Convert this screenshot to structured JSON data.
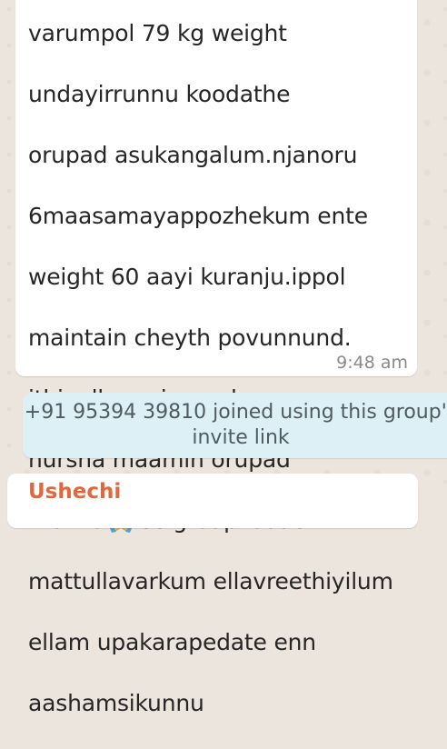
{
  "colors": {
    "wallpaper": "#ece5dd",
    "bubble": "#ffffff",
    "system_note_bg": "#dcf0f5",
    "sender_name": "#e4663b",
    "timestamp": "#8a8a8a"
  },
  "message": {
    "lines_before_emoji": [
      "varumpol 79 kg weight",
      "undayirrunnu koodathe",
      "orupad asukangalum.njanoru",
      "6maasamayappozhekum  ente",
      "weight 60 aayi kuranju.ippol",
      "maintain cheyth povunnund.",
      "ithinellam njangade maam",
      "nursha maamin orupad"
    ],
    "emoji_line": {
      "before": "thanks",
      "emoji": "folded-hands",
      "after": "ee groupiloode"
    },
    "lines_after_emoji": [
      "mattullavarkum ellavreethiyilum",
      "ellam upakarapedate enn",
      "aashamsikunnu"
    ],
    "time": "9:48 am"
  },
  "system_note": {
    "line1": "+91 95394 39810 joined using this group's",
    "line2": "invite link"
  },
  "next_message": {
    "sender": "Ushechi"
  }
}
